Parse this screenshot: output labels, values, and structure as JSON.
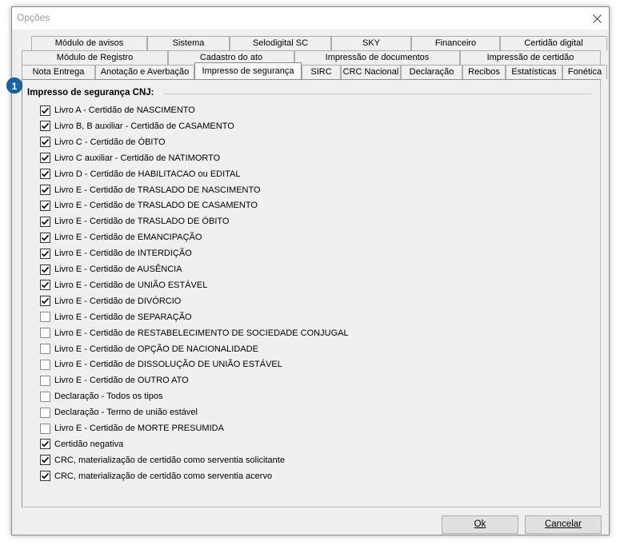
{
  "window": {
    "title": "Opções"
  },
  "badge": {
    "number": "1"
  },
  "tabs": {
    "row1": [
      "Módulo de avisos",
      "Sistema",
      "Selodigital SC",
      "SKY",
      "Financeiro",
      "Certidão digital"
    ],
    "row2": [
      "Módulo de Registro",
      "Cadastro do ato",
      "Impressão de documentos",
      "Impressão de certidão"
    ],
    "row3": [
      "Nota Entrega",
      "Anotação e Averbação",
      "Impresso de segurança",
      "SIRC",
      "CRC Nacional",
      "Declaração",
      "Recibos",
      "Estatísticas",
      "Fonética"
    ],
    "active": "Impresso de segurança"
  },
  "group": {
    "title": "Impresso de segurança CNJ:"
  },
  "checkboxes": [
    {
      "label": "Livro A - Certidão de NASCIMENTO",
      "checked": true
    },
    {
      "label": "Livro B, B auxiliar - Certidão de CASAMENTO",
      "checked": true
    },
    {
      "label": "Livro C - Certidão de ÓBITO",
      "checked": true
    },
    {
      "label": "Livro C auxiliar - Certidão de NATIMORTO",
      "checked": true
    },
    {
      "label": "Livro D - Certidão de HABILITACAO ou EDITAL",
      "checked": true
    },
    {
      "label": "Livro E - Certidão de TRASLADO DE NASCIMENTO",
      "checked": true
    },
    {
      "label": "Livro E - Certidão de TRASLADO DE CASAMENTO",
      "checked": true
    },
    {
      "label": "Livro E - Certidão de TRASLADO DE ÓBITO",
      "checked": true
    },
    {
      "label": "Livro E - Certidão de EMANCIPAÇÃO",
      "checked": true
    },
    {
      "label": "Livro E - Certidão de INTERDIÇÃO",
      "checked": true
    },
    {
      "label": "Livro E - Certidão de AUSÊNCIA",
      "checked": true
    },
    {
      "label": "Livro E - Certidão de UNIÃO ESTÁVEL",
      "checked": true
    },
    {
      "label": "Livro E - Certidão de DIVÓRCIO",
      "checked": true
    },
    {
      "label": "Livro E - Certidão de SEPARAÇÃO",
      "checked": false
    },
    {
      "label": "Livro E - Certidão de RESTABELECIMENTO DE SOCIEDADE CONJUGAL",
      "checked": false
    },
    {
      "label": "Livro E - Certidão de OPÇÃO DE NACIONALIDADE",
      "checked": false
    },
    {
      "label": "Livro E - Certidão de DISSOLUÇÃO DE UNIÃO ESTÁVEL",
      "checked": false
    },
    {
      "label": "Livro E - Certidão de OUTRO ATO",
      "checked": false
    },
    {
      "label": "Declaração - Todos os tipos",
      "checked": false
    },
    {
      "label": "Declaração - Termo de união estável",
      "checked": false
    },
    {
      "label": "Livro E - Certidão de MORTE PRESUMIDA",
      "checked": false
    },
    {
      "label": "Certidão negativa",
      "checked": true
    },
    {
      "label": "CRC, materialização de certidão como serventia solicitante",
      "checked": true
    },
    {
      "label": "CRC, materialização de certidão como serventia acervo",
      "checked": true
    }
  ],
  "buttons": {
    "ok": "Ok",
    "cancel": "Cancelar"
  }
}
